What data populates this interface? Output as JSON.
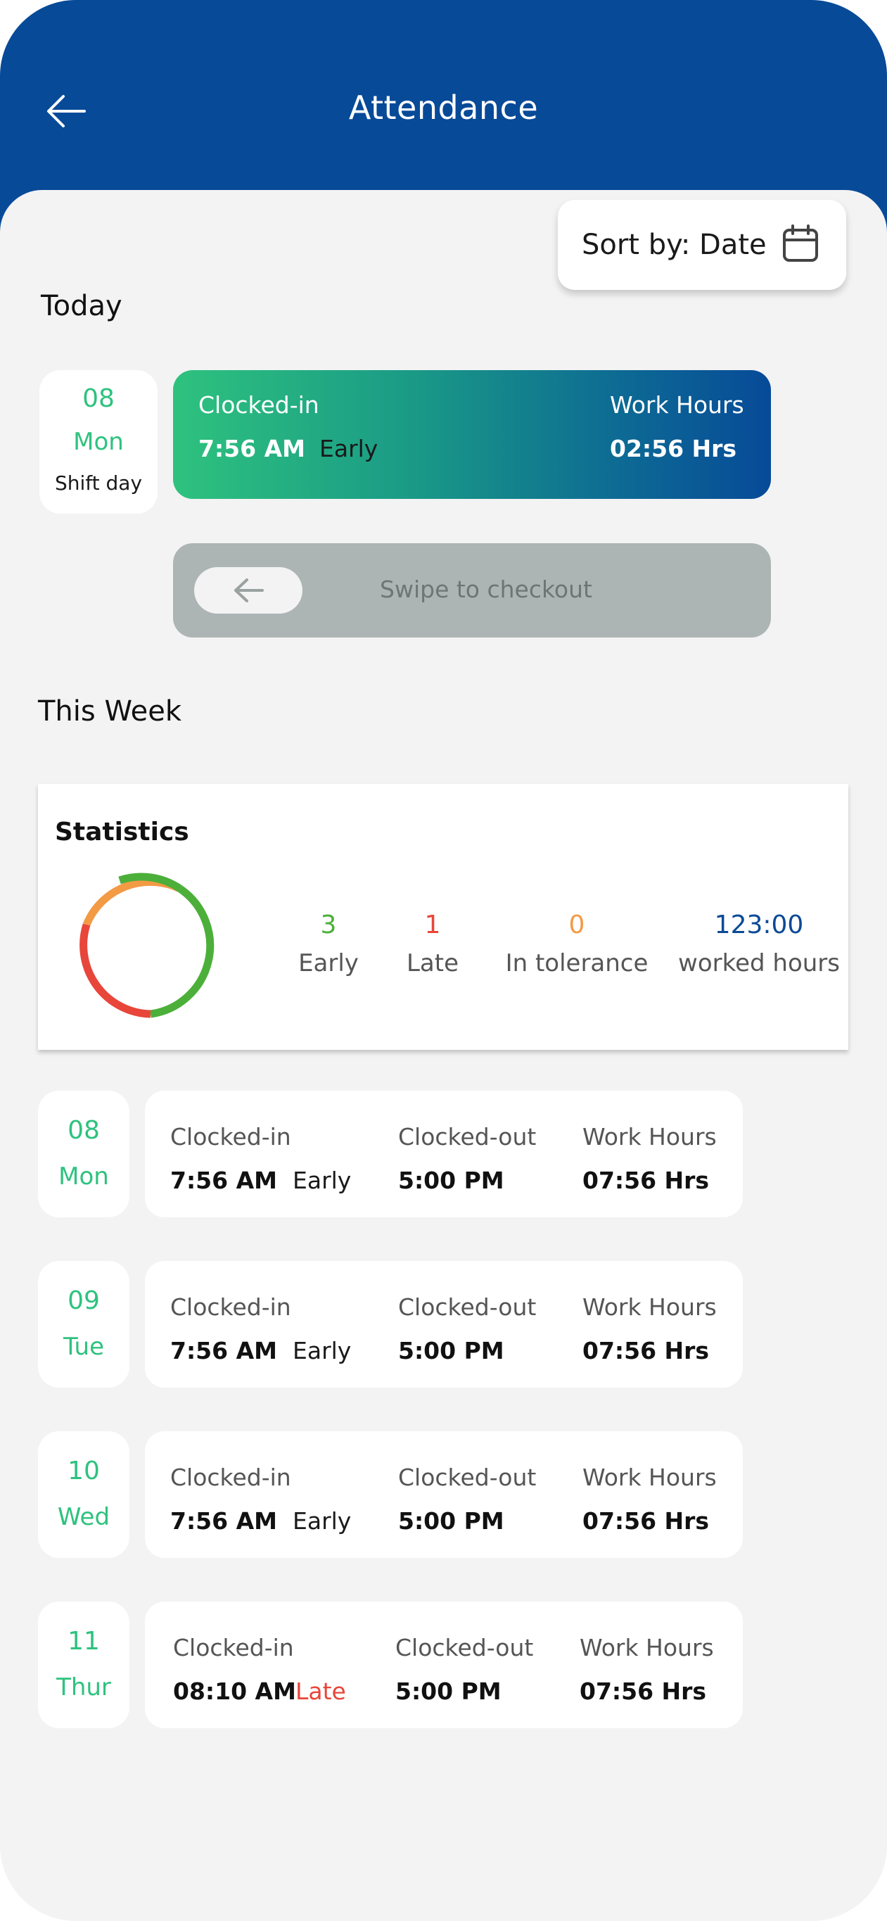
{
  "header": {
    "title": "Attendance"
  },
  "sort": {
    "label": "Sort by: Date"
  },
  "today": {
    "section_title": "Today",
    "date": {
      "day": "08",
      "weekday": "Mon",
      "note": "Shift day"
    },
    "clocked_in_label": "Clocked-in",
    "clocked_in_time": "7:56 AM",
    "status": "Early",
    "work_hours_label": "Work Hours",
    "work_hours": "02:56 Hrs",
    "swipe_label": "Swipe to checkout"
  },
  "week": {
    "section_title": "This Week",
    "statistics": {
      "title": "Statistics",
      "early": {
        "value": 3,
        "label": "Early"
      },
      "late": {
        "value": 1,
        "label": "Late"
      },
      "tolerance": {
        "value": 0,
        "label": "In tolerance"
      },
      "worked": {
        "value": "123:00",
        "label": "worked hours"
      }
    },
    "labels": {
      "in": "Clocked-in",
      "out": "Clocked-out",
      "hours": "Work Hours"
    },
    "days": [
      {
        "day": "08",
        "weekday": "Mon",
        "in": "7:56 AM",
        "status": "Early",
        "out": "5:00 PM",
        "hours": "07:56 Hrs"
      },
      {
        "day": "09",
        "weekday": "Tue",
        "in": "7:56 AM",
        "status": "Early",
        "out": "5:00 PM",
        "hours": "07:56 Hrs"
      },
      {
        "day": "10",
        "weekday": "Wed",
        "in": "7:56 AM",
        "status": "Early",
        "out": "5:00 PM",
        "hours": "07:56 Hrs"
      },
      {
        "day": "11",
        "weekday": "Thur",
        "in": "08:10 AM",
        "status": "Late",
        "out": "5:00 PM",
        "hours": "07:56 Hrs"
      }
    ]
  },
  "colors": {
    "brand": "#074a98",
    "early": "#4caf3a",
    "late": "#e8463a",
    "tolerance": "#f39a45",
    "worked": "#0b4a96",
    "date": "#2ec27e"
  }
}
